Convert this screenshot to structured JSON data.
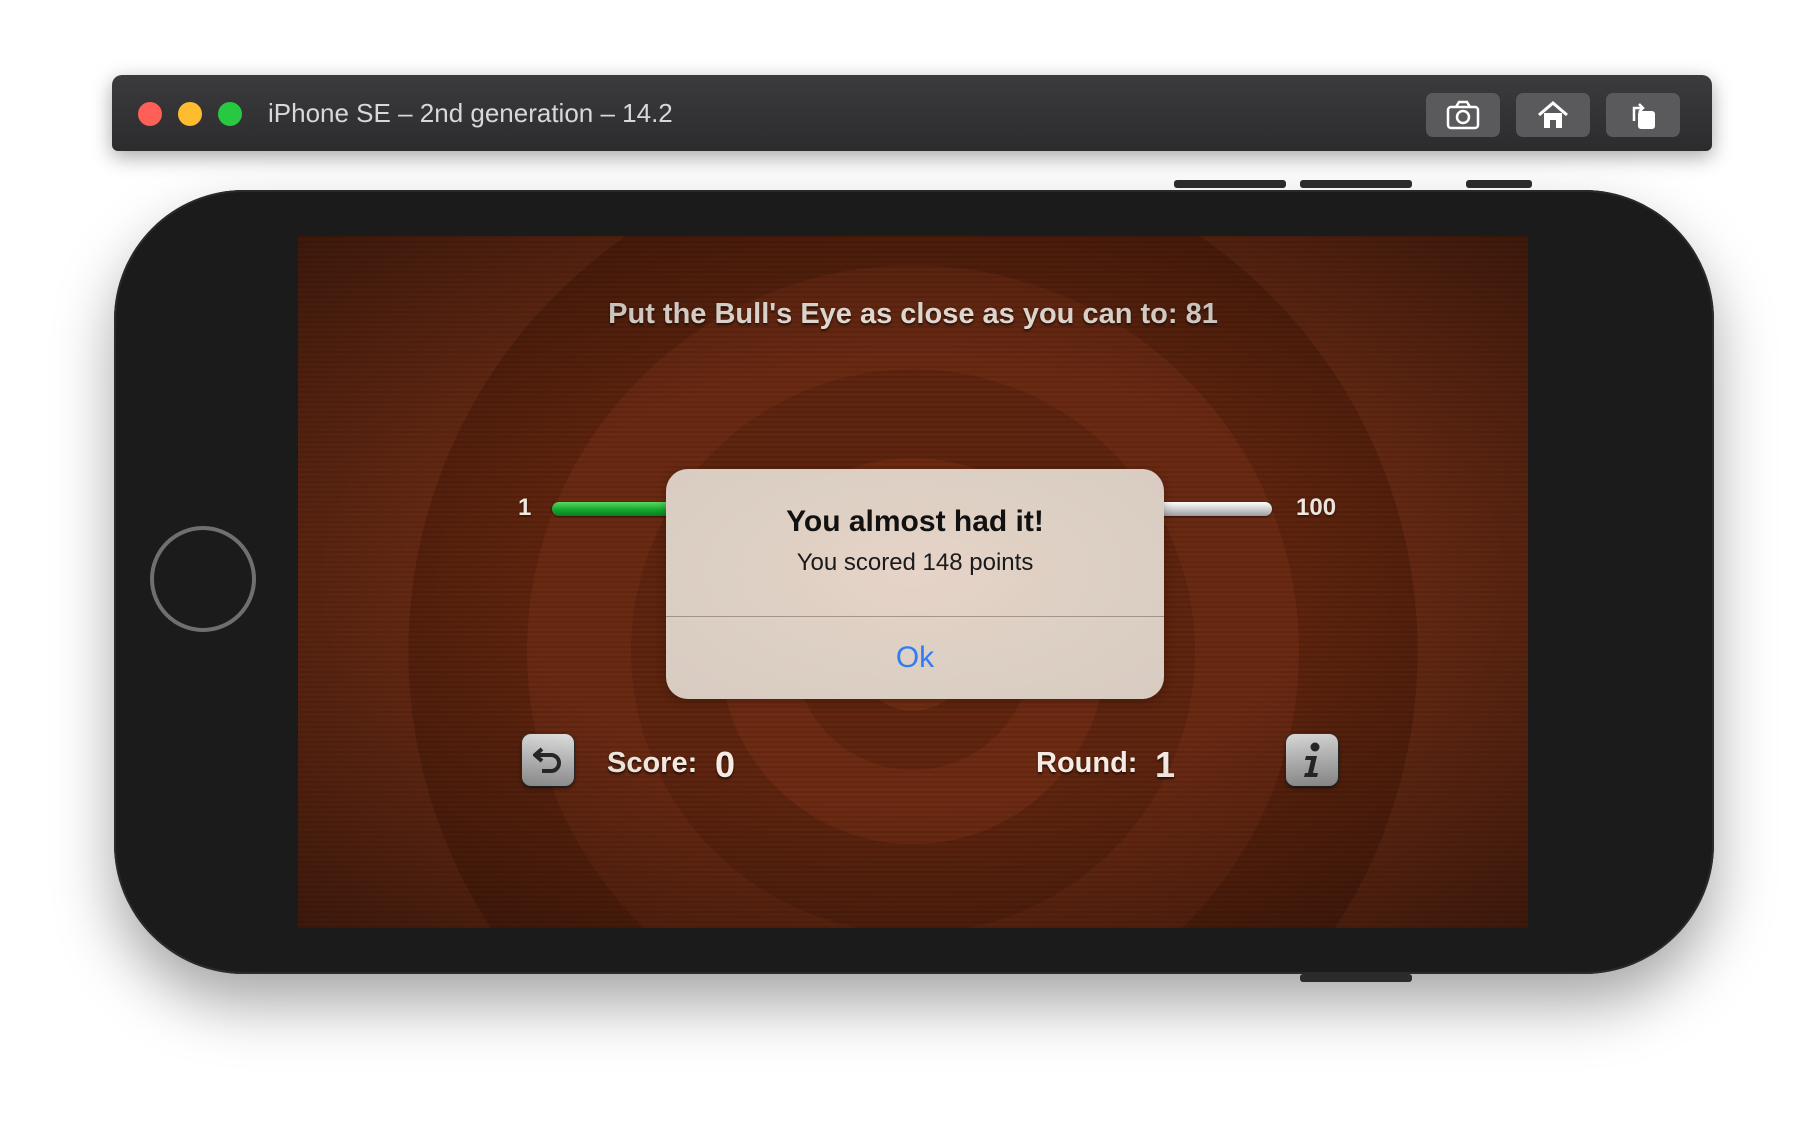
{
  "window": {
    "title": "iPhone SE – 2nd generation – 14.2",
    "toolbar": [
      {
        "icon": "camera-icon"
      },
      {
        "icon": "home-icon"
      },
      {
        "icon": "rotate-icon"
      }
    ]
  },
  "game": {
    "instruction": "Put the Bull's Eye as close as you can to:  81",
    "slider": {
      "min_label": "1",
      "max_label": "100"
    },
    "score_label": "Score:",
    "score_value": "0",
    "round_label": "Round:",
    "round_value": "1",
    "restart_icon": "restart-icon",
    "info_icon": "info-icon"
  },
  "alert": {
    "title": "You almost had it!",
    "message": "You scored 148 points",
    "ok_label": "Ok"
  },
  "colors": {
    "alert_button": "#2f7cf6",
    "slider_fill": "#12a22c",
    "background": "#6a2810"
  }
}
